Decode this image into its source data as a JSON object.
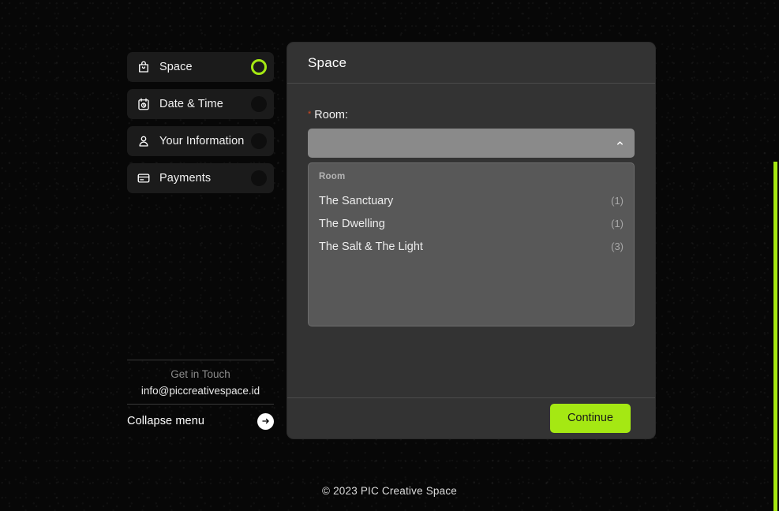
{
  "sidebar": {
    "items": [
      {
        "label": "Space",
        "icon": "shopping-bag-icon",
        "active": true
      },
      {
        "label": "Date & Time",
        "icon": "calendar-clock-icon",
        "active": false
      },
      {
        "label": "Your Information",
        "icon": "user-icon",
        "active": false
      },
      {
        "label": "Payments",
        "icon": "credit-card-icon",
        "active": false
      }
    ],
    "contact": {
      "title": "Get in Touch",
      "email": "info@piccreativespace.id"
    },
    "collapse": {
      "label": "Collapse menu",
      "icon": "arrow-right-circle-icon"
    }
  },
  "panel": {
    "title": "Space",
    "field": {
      "required_marker": "*",
      "label": "Room:",
      "value": "",
      "placeholder": "",
      "caret_icon": "chevron-up-icon"
    },
    "dropdown": {
      "group_label": "Room",
      "options": [
        {
          "label": "The Sanctuary",
          "count": "(1)"
        },
        {
          "label": "The Dwelling",
          "count": "(1)"
        },
        {
          "label": "The Salt & The Light",
          "count": "(3)"
        }
      ]
    },
    "footer": {
      "continue_label": "Continue"
    }
  },
  "page_footer": {
    "copyright": "© 2023 PIC Creative Space"
  },
  "colors": {
    "accent_green": "#a5e813",
    "panel_bg": "#333333",
    "select_bg": "#8a8a8a",
    "dropdown_bg": "#585858",
    "required_red": "#d4471f"
  }
}
